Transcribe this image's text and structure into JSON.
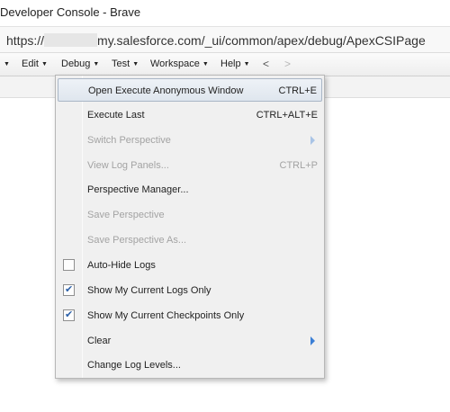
{
  "window": {
    "title": "Developer Console - Brave"
  },
  "address_bar": {
    "prefix": "https://",
    "url_rest": "my.salesforce.com/_ui/common/apex/debug/ApexCSIPage"
  },
  "menubar": {
    "items": [
      {
        "label": "Edit"
      },
      {
        "label": "Debug"
      },
      {
        "label": "Test"
      },
      {
        "label": "Workspace"
      },
      {
        "label": "Help"
      }
    ],
    "back_label": "<",
    "forward_label": ">"
  },
  "debug_menu": {
    "items": [
      {
        "label": "Open Execute Anonymous Window",
        "shortcut": "CTRL+E",
        "state": "hover"
      },
      {
        "label": "Execute Last",
        "shortcut": "CTRL+ALT+E"
      },
      {
        "label": "Switch Perspective",
        "state": "disabled",
        "submenu": true
      },
      {
        "label": "View Log Panels...",
        "shortcut": "CTRL+P",
        "state": "disabled"
      },
      {
        "label": "Perspective Manager..."
      },
      {
        "label": "Save Perspective",
        "state": "disabled"
      },
      {
        "label": "Save Perspective As...",
        "state": "disabled"
      },
      {
        "label": "Auto-Hide Logs",
        "checked": false
      },
      {
        "label": "Show My Current Logs Only",
        "checked": true
      },
      {
        "label": "Show My Current Checkpoints Only",
        "checked": true
      },
      {
        "label": "Clear",
        "submenu": true
      },
      {
        "label": "Change Log Levels..."
      }
    ]
  },
  "colors": {
    "submenu_arrow": "#3b7fd6",
    "check": "#2a5fa8",
    "disabled_text": "#a3a3a3"
  }
}
